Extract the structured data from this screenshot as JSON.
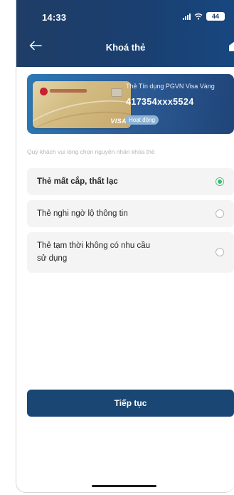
{
  "status_bar": {
    "time": "14:33",
    "battery": "44"
  },
  "header": {
    "title": "Khoá thẻ",
    "back_icon": "arrow-left-icon",
    "home_icon": "home-icon"
  },
  "card": {
    "name": "Thẻ Tín dụng PGVN Visa Vàng",
    "number": "417354xxx5524",
    "status": "Hoạt động",
    "network": "VISA"
  },
  "instruction": "Quý khách vui lòng chọn nguyên nhân khóa thẻ",
  "reasons": [
    {
      "label": "Thẻ mất cắp, thất lạc",
      "selected": true
    },
    {
      "label": "Thẻ nghi ngờ lộ thông tin",
      "selected": false
    },
    {
      "label_line1": "Thẻ tạm thời không có nhu cầu",
      "label_line2": "sử dụng",
      "selected": false
    }
  ],
  "continue_button": "Tiếp tục",
  "colors": {
    "header": "#1f3d66",
    "button": "#1a4673",
    "radio_selected": "#3cbc6e"
  }
}
